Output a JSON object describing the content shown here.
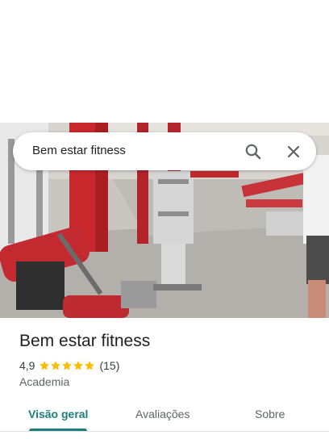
{
  "search": {
    "query": "Bem estar fitness"
  },
  "place": {
    "name": "Bem estar fitness",
    "rating": "4,9",
    "stars": 5,
    "review_count": "(15)",
    "category": "Academia"
  },
  "tabs": [
    {
      "label": "Visão geral",
      "active": true
    },
    {
      "label": "Avaliações",
      "active": false
    },
    {
      "label": "Sobre",
      "active": false
    }
  ],
  "icons": {
    "search": "search-icon",
    "close": "close-icon",
    "star": "star-icon"
  },
  "colors": {
    "accent": "#1a7f7a",
    "star": "#fbbc04",
    "text": "#202124"
  }
}
